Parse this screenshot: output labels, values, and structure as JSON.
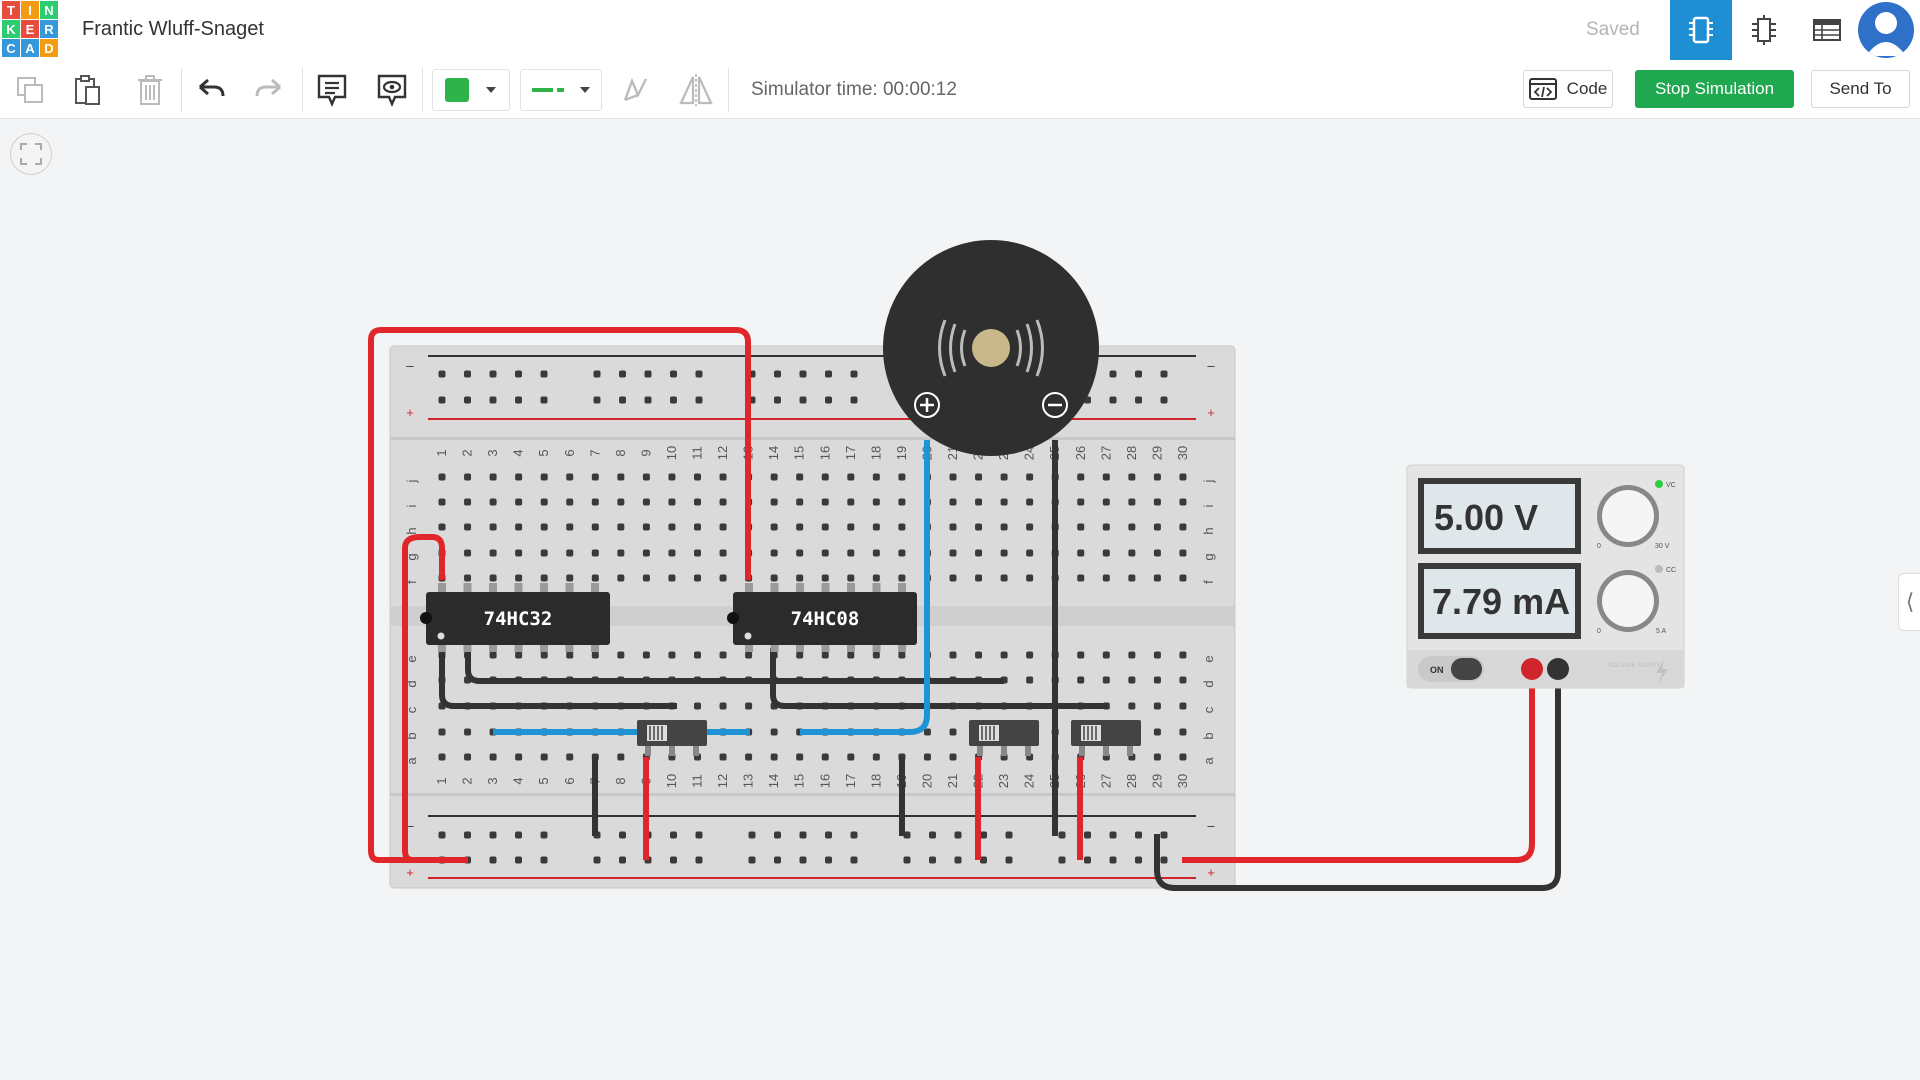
{
  "app": {
    "logo_letters": [
      "T",
      "I",
      "N",
      "K",
      "E",
      "R",
      "C",
      "A",
      "D"
    ],
    "logo_colors": [
      "#e84c3d",
      "#f39c12",
      "#2ecc71",
      "#2ecc71",
      "#e84c3d",
      "#3498db",
      "#3498db",
      "#3498db",
      "#f39c12"
    ],
    "project_title": "Frantic Wluff-Snaget",
    "save_status": "Saved"
  },
  "view_switcher": [
    {
      "name": "circuit-view-icon",
      "active": true
    },
    {
      "name": "schematic-view-icon",
      "active": false
    },
    {
      "name": "component-list-icon",
      "active": false
    }
  ],
  "toolbar": {
    "wire_color": "#2db34a",
    "simulator_time_label": "Simulator time: 00:00:12",
    "code_label": "Code",
    "stop_simulation_label": "Stop Simulation",
    "send_to_label": "Send To"
  },
  "circuit": {
    "chips": [
      "74HC32",
      "74HC08"
    ],
    "breadboard_rows_top": [
      "j",
      "i",
      "h",
      "g",
      "f"
    ],
    "breadboard_rows_bottom": [
      "e",
      "d",
      "c",
      "b",
      "a"
    ],
    "column_numbers": [
      "1",
      "2",
      "3",
      "4",
      "5",
      "6",
      "7",
      "8",
      "9",
      "10",
      "11",
      "12",
      "13",
      "14",
      "15",
      "16",
      "17",
      "18",
      "19",
      "20",
      "21",
      "22",
      "23",
      "24",
      "25",
      "26",
      "27",
      "28",
      "29",
      "30"
    ],
    "rail_minus": "–",
    "rail_plus": "+",
    "power_supply": {
      "voltage_display": "5.00 V",
      "current_display": "7.79 mA",
      "on_label": "ON",
      "cv_label": "VC",
      "cc_label": "CC",
      "knob1_min": "0",
      "knob1_max": "30 V",
      "knob2_min": "0",
      "knob2_max": "5 A",
      "brand_label": "VOLTAGE SUPPLY"
    },
    "wire_colors": {
      "red": "#e0262b",
      "black": "#333333",
      "blue": "#1e93d6"
    }
  }
}
